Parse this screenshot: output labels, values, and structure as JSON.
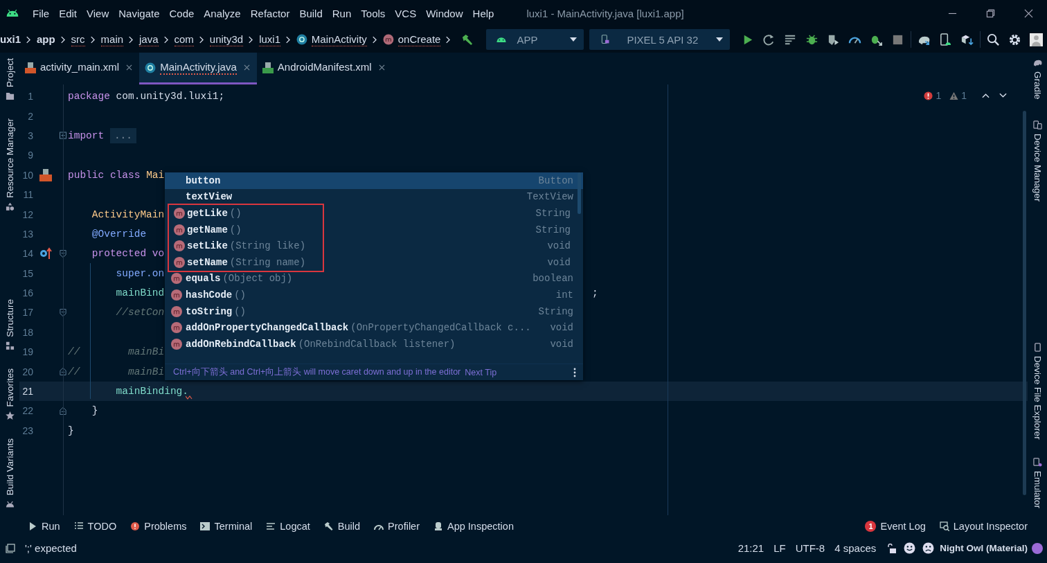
{
  "menubar": {
    "menus": [
      "File",
      "Edit",
      "View",
      "Navigate",
      "Code",
      "Analyze",
      "Refactor",
      "Build",
      "Run",
      "Tools",
      "VCS",
      "Window",
      "Help"
    ],
    "title": "luxi1 - MainActivity.java [luxi1.app]"
  },
  "navbar": {
    "crumbs": [
      {
        "label": "uxi1",
        "kind": "module",
        "error": false
      },
      {
        "label": "app",
        "kind": "module",
        "error": false
      },
      {
        "label": "src",
        "kind": "folder",
        "error": true
      },
      {
        "label": "main",
        "kind": "folder",
        "error": true
      },
      {
        "label": "java",
        "kind": "folder",
        "error": true
      },
      {
        "label": "com",
        "kind": "folder",
        "error": true
      },
      {
        "label": "unity3d",
        "kind": "folder",
        "error": true
      },
      {
        "label": "luxi1",
        "kind": "folder",
        "error": true
      },
      {
        "label": "MainActivity",
        "kind": "class",
        "error": true
      },
      {
        "label": "onCreate",
        "kind": "method",
        "error": true
      }
    ],
    "run_config": "APP",
    "device": "PIXEL 5 API 32"
  },
  "left_tools": {
    "top": [
      {
        "label": "Project",
        "kind": "folder"
      },
      {
        "label": "Resource Manager",
        "kind": "shapes"
      }
    ],
    "bottom": [
      {
        "label": "Structure",
        "kind": "structure"
      },
      {
        "label": "Favorites",
        "kind": "star"
      },
      {
        "label": "Build Variants",
        "kind": "android"
      }
    ]
  },
  "right_tools": {
    "top": [
      {
        "label": "Gradle",
        "kind": "elephant"
      },
      {
        "label": "Device Manager",
        "kind": "devices"
      }
    ],
    "bottom": [
      {
        "label": "Device File Explorer",
        "kind": "phone"
      },
      {
        "label": "Emulator",
        "kind": "emulator"
      }
    ]
  },
  "tabs": [
    {
      "label": "activity_main.xml",
      "kind": "layout",
      "selected": false,
      "error": false
    },
    {
      "label": "MainActivity.java",
      "kind": "class",
      "selected": true,
      "error": true
    },
    {
      "label": "AndroidManifest.xml",
      "kind": "manifest",
      "selected": false,
      "error": false
    }
  ],
  "inspections": {
    "errors": "1",
    "warnings": "1"
  },
  "code": {
    "lines": [
      {
        "number": "1",
        "current": false,
        "tokens": [
          {
            "kind": "keyword",
            "text": "package"
          },
          {
            "kind": "plain",
            "text": " com.unity3d.luxi1;"
          }
        ]
      },
      {
        "number": "2",
        "current": false
      },
      {
        "number": "3",
        "current": false,
        "folded": true,
        "tokens": [
          {
            "kind": "keyword",
            "text": "import"
          },
          {
            "kind": "folded",
            "text": "..."
          }
        ]
      },
      {
        "number": "9",
        "current": false
      },
      {
        "number": "10",
        "current": false,
        "class_marker": true,
        "tokens": [
          {
            "kind": "keyword",
            "text": "public class "
          },
          {
            "kind": "type",
            "text": "Mai"
          }
        ]
      },
      {
        "number": "11",
        "current": false
      },
      {
        "number": "12",
        "current": false,
        "tokens": [
          {
            "kind": "type",
            "text": "    ActivityMain"
          }
        ]
      },
      {
        "number": "13",
        "current": false,
        "tokens": [
          {
            "kind": "annotation",
            "text": "    @Override"
          }
        ]
      },
      {
        "number": "14",
        "current": false,
        "override_marker": true,
        "fold_start": true,
        "tokens": [
          {
            "kind": "keyword",
            "text": "    protected vo"
          }
        ]
      },
      {
        "number": "15",
        "current": false,
        "tokens": [
          {
            "kind": "call",
            "text": "        super.on"
          }
        ]
      },
      {
        "number": "16",
        "current": false,
        "tokens": [
          {
            "kind": "field",
            "text": "        mainBind"
          },
          {
            "kind": "plain",
            "text": "                                                                       ;"
          }
        ]
      },
      {
        "number": "17",
        "current": false,
        "fold_start": true,
        "tokens": [
          {
            "kind": "comment",
            "text": "        //setCon"
          }
        ]
      },
      {
        "number": "18",
        "current": false
      },
      {
        "number": "19",
        "current": false,
        "tokens": [
          {
            "kind": "comment",
            "text": "//"
          },
          {
            "kind": "comment",
            "text": "        mainBi"
          }
        ]
      },
      {
        "number": "20",
        "current": false,
        "fold_end": true,
        "tokens": [
          {
            "kind": "comment",
            "text": "//"
          },
          {
            "kind": "comment",
            "text": "        mainBi"
          }
        ]
      },
      {
        "number": "21",
        "current": true,
        "error": true,
        "tokens": [
          {
            "kind": "field",
            "text": "        mainBinding."
          }
        ]
      },
      {
        "number": "22",
        "current": false,
        "fold_end": true,
        "tokens": [
          {
            "kind": "plain",
            "text": "    }"
          }
        ]
      },
      {
        "number": "23",
        "current": false,
        "tokens": [
          {
            "kind": "plain",
            "text": "}"
          }
        ]
      }
    ]
  },
  "completion": {
    "groups": [
      {
        "boxed": false,
        "items": [
          {
            "kind": "field",
            "name": "button",
            "type": "Button",
            "selected": true
          },
          {
            "kind": "field",
            "name": "textView",
            "type": "TextView",
            "selected": false
          }
        ]
      },
      {
        "boxed": true,
        "items": [
          {
            "kind": "method",
            "name": "getLike",
            "params": "()",
            "type": "String",
            "selected": false
          },
          {
            "kind": "method",
            "name": "getName",
            "params": "()",
            "type": "String",
            "selected": false
          },
          {
            "kind": "method",
            "name": "setLike",
            "params": "(String like)",
            "type": "void",
            "selected": false
          },
          {
            "kind": "method",
            "name": "setName",
            "params": "(String name)",
            "type": "void",
            "selected": false
          }
        ]
      },
      {
        "boxed": false,
        "items": [
          {
            "kind": "method",
            "name": "equals",
            "params": "(Object obj)",
            "type": "boolean",
            "selected": false
          },
          {
            "kind": "method",
            "name": "hashCode",
            "params": "()",
            "type": "int",
            "selected": false
          },
          {
            "kind": "method",
            "name": "toString",
            "params": "()",
            "type": "String",
            "selected": false
          },
          {
            "kind": "method",
            "name": "addOnPropertyChangedCallback",
            "params": "(OnPropertyChangedCallback c...",
            "type": "void",
            "selected": false
          },
          {
            "kind": "method",
            "name": "addOnRebindCallback",
            "params": "(OnRebindCallback listener)",
            "type": "void",
            "selected": false
          }
        ]
      }
    ],
    "hint": "Ctrl+向下箭头 and Ctrl+向上箭头 will move caret down and up in the editor",
    "hint_link": "Next Tip"
  },
  "tool_windows": [
    {
      "label": "Run",
      "kind": "run"
    },
    {
      "label": "TODO",
      "kind": "todo"
    },
    {
      "label": "Problems",
      "kind": "problems"
    },
    {
      "label": "Terminal",
      "kind": "terminal"
    },
    {
      "label": "Logcat",
      "kind": "logcat"
    },
    {
      "label": "Build",
      "kind": "build"
    },
    {
      "label": "Profiler",
      "kind": "profiler"
    },
    {
      "label": "App Inspection",
      "kind": "inspection"
    }
  ],
  "tool_windows_right": [
    {
      "label": "Event Log",
      "kind": "log",
      "badge": "1"
    },
    {
      "label": "Layout Inspector",
      "kind": "layout"
    }
  ],
  "status": {
    "message": "';' expected",
    "items": [
      "21:21",
      "LF",
      "UTF-8",
      "4 spaces"
    ],
    "theme": "Night Owl (Material)"
  }
}
